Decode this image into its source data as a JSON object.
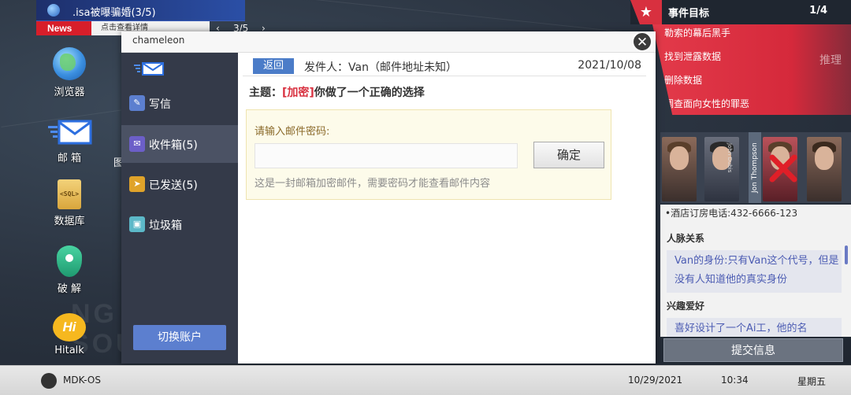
{
  "news": {
    "headline": ".isa被曝骗婚(3/5)",
    "label": "News",
    "detail_link": "点击查看详情",
    "page_indicator": "3/5"
  },
  "desktop": {
    "icons": [
      {
        "label": "浏览器",
        "icon": "globe-icon"
      },
      {
        "label": "邮  箱",
        "icon": "mail-icon"
      },
      {
        "label": "数据库",
        "icon": "sql-database-icon"
      },
      {
        "label": "破  解",
        "icon": "key-shield-icon"
      },
      {
        "label": "Hitalk",
        "icon": "hitalk-icon"
      }
    ],
    "partial_icon_label": "图",
    "bg_text": [
      "NG",
      "SOUT"
    ]
  },
  "task_panel": {
    "title": "事件目标",
    "count": "1/4",
    "items": [
      "勒索的幕后黑手",
      "找到泄露数据",
      "删除数据",
      "调查面向女性的罪恶"
    ],
    "reason_label": "推理"
  },
  "suspects": {
    "tag_name": "Jon Thompson",
    "overlay_names": [
      "John Dubis"
    ]
  },
  "info_panel": {
    "hotel_line": "•酒店订房电话:432-6666-123",
    "relation_heading": "人脉关系",
    "relation_text": "Van的身份:只有Van这个代号，但是没有人知道他的真实身份",
    "hobby_heading": "兴趣爱好",
    "hobby_text": "喜好设计了一个Ai工，他的名"
  },
  "submit_label": "提交信息",
  "mail": {
    "window_title": "chameleon",
    "sidebar": [
      {
        "label": "写信",
        "icon": "compose-icon",
        "color": "#5c7fcf"
      },
      {
        "label": "收件箱(5)",
        "icon": "inbox-icon",
        "color": "#6c5fc8"
      },
      {
        "label": "已发送(5)",
        "icon": "send-icon",
        "color": "#e0a32a"
      },
      {
        "label": "垃圾箱",
        "icon": "trash-icon",
        "color": "#5cb8c8"
      }
    ],
    "switch_account": "切换账户",
    "back": "返回",
    "sender": "发件人：Van（邮件地址未知）",
    "date": "2021/10/08",
    "subject_prefix": "主题：",
    "subject_tag": "[加密]",
    "subject_text": "你做了一个正确的选择",
    "password_label": "请输入邮件密码:",
    "password_value": "",
    "confirm": "确定",
    "hint": "这是一封邮箱加密邮件，需要密码才能查看邮件内容"
  },
  "taskbar": {
    "os_name": "MDK-OS",
    "date": "10/29/2021",
    "time": "10:34",
    "weekday": "星期五"
  },
  "colors": {
    "accent_red": "#d8303f",
    "sidebar_dark": "#343a49",
    "button_blue": "#5c7fcf"
  }
}
